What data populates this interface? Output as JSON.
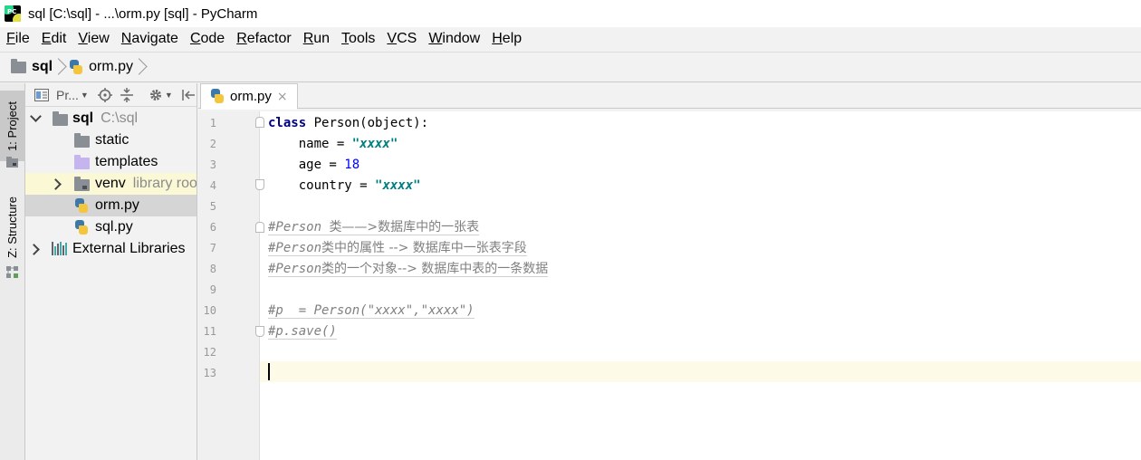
{
  "window": {
    "title": "sql [C:\\sql] - ...\\orm.py [sql] - PyCharm",
    "app_icon_label": "PC"
  },
  "menu": [
    {
      "mnemonic": "F",
      "rest": "ile"
    },
    {
      "mnemonic": "E",
      "rest": "dit"
    },
    {
      "mnemonic": "V",
      "rest": "iew"
    },
    {
      "mnemonic": "N",
      "rest": "avigate"
    },
    {
      "mnemonic": "C",
      "rest": "ode"
    },
    {
      "mnemonic": "R",
      "rest": "efactor"
    },
    {
      "mnemonic": "R",
      "rest": "un",
      "prefix": ""
    },
    {
      "mnemonic": "T",
      "rest": "ools"
    },
    {
      "mnemonic": "V",
      "rest": "CS"
    },
    {
      "mnemonic": "W",
      "rest": "indow"
    },
    {
      "mnemonic": "H",
      "rest": "elp"
    }
  ],
  "breadcrumb": {
    "project": "sql",
    "file": "orm.py"
  },
  "tool_stripe": {
    "project_tab": "1: Project",
    "structure_tab": "Z: Structure"
  },
  "project_panel": {
    "toolbar_label": "Pr...",
    "tree": {
      "root_name": "sql",
      "root_path": "C:\\sql",
      "static": "static",
      "templates": "templates",
      "venv": "venv",
      "venv_hint": "library root",
      "orm": "orm.py",
      "sql": "sql.py",
      "external": "External Libraries"
    }
  },
  "editor": {
    "tab_label": "orm.py",
    "tab_close": "×",
    "line_numbers": [
      "1",
      "2",
      "3",
      "4",
      "5",
      "6",
      "7",
      "8",
      "9",
      "10",
      "11",
      "12",
      "13"
    ],
    "code": {
      "l1_kw": "class",
      "l1_rest": " Person(object):",
      "l2_name": "    name = ",
      "l2_str": "\"xxxx\"",
      "l3_name": "    age = ",
      "l3_num": "18",
      "l4_name": "    country = ",
      "l4_str": "\"xxxx\"",
      "l6_hash": "#Person ",
      "l6_text": "类——>数据库中的一张表",
      "l7_hash": "#Person",
      "l7_text": "类中的属性 --> 数据库中一张表字段",
      "l8_hash": "#Person",
      "l8_text": "类的一个对象--> 数据库中表的一条数据",
      "l10": "#p  = Person(\"xxxx\",\"xxxx\")",
      "l11": "#p.save()"
    }
  }
}
